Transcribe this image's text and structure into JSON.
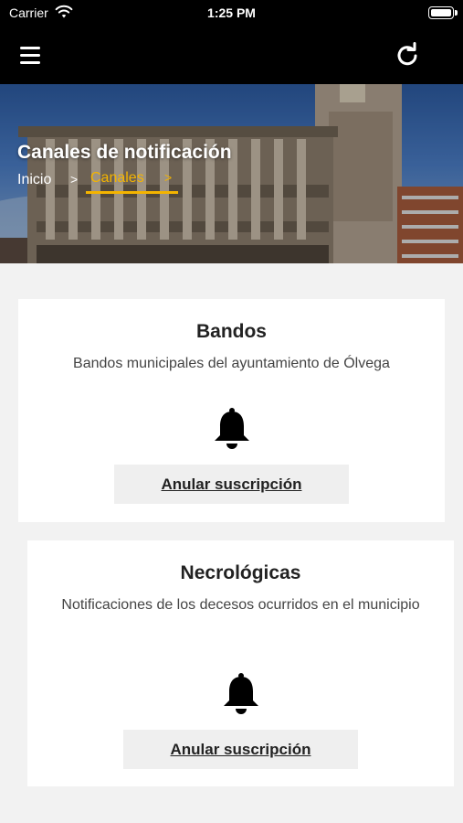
{
  "status_bar": {
    "carrier": "Carrier",
    "time": "1:25 PM"
  },
  "hero": {
    "title": "Canales de notificación",
    "breadcrumb": {
      "home": "Inicio",
      "separator": ">",
      "current": "Canales",
      "current_separator": ">"
    }
  },
  "channels": [
    {
      "title": "Bandos",
      "description": "Bandos municipales del ayuntamiento de Ólvega",
      "button_label": "Anular suscripción"
    },
    {
      "title": "Necrológicas",
      "description": "Notificaciones de los decesos ocurridos en el municipio",
      "button_label": "Anular suscripción"
    }
  ],
  "colors": {
    "accent": "#f4b400",
    "nav_background": "#000000",
    "page_background": "#f2f2f2"
  },
  "icons": {
    "menu": "hamburger-icon",
    "refresh": "refresh-icon",
    "bell": "bell-icon"
  }
}
